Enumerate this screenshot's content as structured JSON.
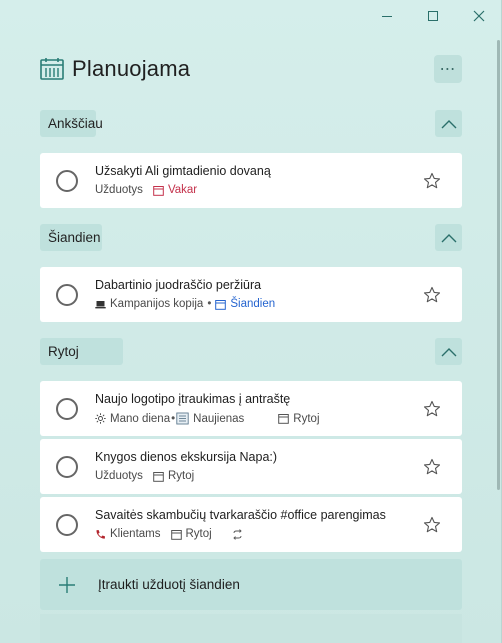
{
  "window": {
    "minimize_icon": "minimize-icon",
    "maximize_icon": "maximize-icon",
    "close_icon": "close-icon"
  },
  "header": {
    "icon": "calendar-grid-icon",
    "title": "Planuojama",
    "more_label": "⋯"
  },
  "groups": [
    {
      "label": "Ankščiau",
      "tasks": [
        {
          "title": "Užsakyti Ali gimtadienio dovaną",
          "list": "Užduotys",
          "due": "Vakar",
          "due_color": "#c4314b"
        }
      ]
    },
    {
      "label": "Šiandien",
      "tasks": [
        {
          "title": "Dabartinio juodraščio peržiūra",
          "list": "Kampanijos kopija",
          "separator": "•",
          "due": "Šiandien",
          "due_color": "#2564cf"
        }
      ]
    },
    {
      "label": "Rytoj",
      "tasks": [
        {
          "title": "Naujo logotipo įtraukimas į antraštę",
          "my_day": "Mano diena",
          "separator": "•",
          "list": "Naujienas",
          "due": "Rytoj"
        },
        {
          "title": "Knygos dienos ekskursija Napa:)",
          "list": "Užduotys",
          "due": "Rytoj"
        },
        {
          "title": "Savaitės skambučių tvarkaraščio #office parengimas",
          "list": "Klientams",
          "due": "Rytoj"
        }
      ]
    }
  ],
  "add_task": {
    "label": "Įtraukti užduotį šiandien"
  },
  "colors": {
    "accent": "#2a7d76",
    "background": "#cfe9e6",
    "panel": "#bfe1dd"
  }
}
